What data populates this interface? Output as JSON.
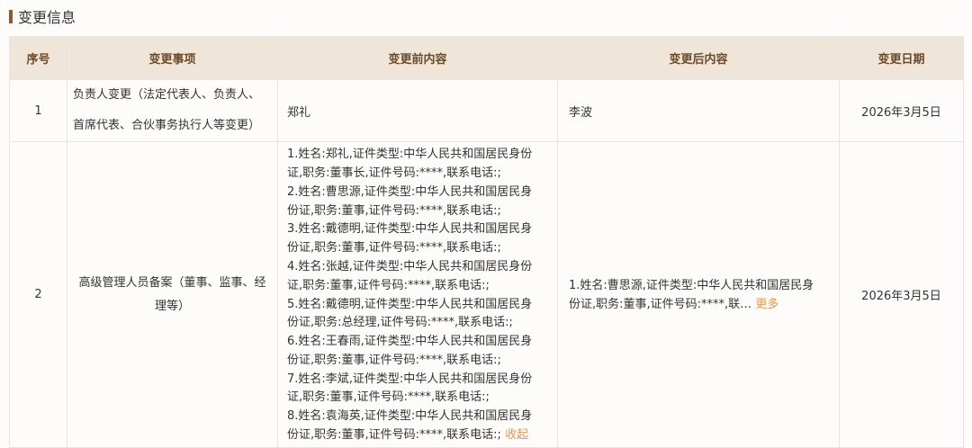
{
  "section": {
    "title": "变更信息"
  },
  "table": {
    "headers": [
      "序号",
      "变更事项",
      "变更前内容",
      "变更后内容",
      "变更日期"
    ],
    "row1": {
      "index": "1",
      "item_line1": "负责人变更（法定代表人、负责人、",
      "item_line2": "首席代表、合伙事务执行人等变更）",
      "before": "郑礼",
      "after": "李波",
      "date": "2026年3月5日"
    },
    "row2": {
      "index": "2",
      "item_line1": "高级管理人员备案（董事、监事、经",
      "item_line2": "理等）",
      "before_lines": [
        "1.姓名:郑礼,证件类型:中华人民共和国居民身份",
        "证,职务:董事长,证件号码:****,联系电话:;",
        "2.姓名:曹思源,证件类型:中华人民共和国居民身",
        "份证,职务:董事,证件号码:****,联系电话:;",
        "3.姓名:戴德明,证件类型:中华人民共和国居民身",
        "份证,职务:董事,证件号码:****,联系电话:;",
        "4.姓名:张越,证件类型:中华人民共和国居民身份",
        "证,职务:董事,证件号码:****,联系电话:;",
        "5.姓名:戴德明,证件类型:中华人民共和国居民身",
        "份证,职务:总经理,证件号码:****,联系电话:;",
        "6.姓名:王春雨,证件类型:中华人民共和国居民身",
        "份证,职务:董事,证件号码:****,联系电话:;",
        "7.姓名:李斌,证件类型:中华人民共和国居民身份",
        "证,职务:董事,证件号码:****,联系电话:;",
        "8.姓名:袁海英,证件类型:中华人民共和国居民身",
        "份证,职务:董事,证件号码:****,联系电话:;"
      ],
      "collapse_label": "收起",
      "after_line1": "1.姓名:曹思源,证件类型:中华人民共和国居民身",
      "after_line2": "份证,职务:董事,证件号码:****,联…",
      "more_label": "更多",
      "date": "2026年3月5日"
    }
  },
  "colors": {
    "header_bg": "#efe5d8",
    "header_text": "#6b4a2a",
    "accent_bar": "#8a5a2b",
    "link": "#e8964a",
    "border": "#e9e4dc"
  }
}
